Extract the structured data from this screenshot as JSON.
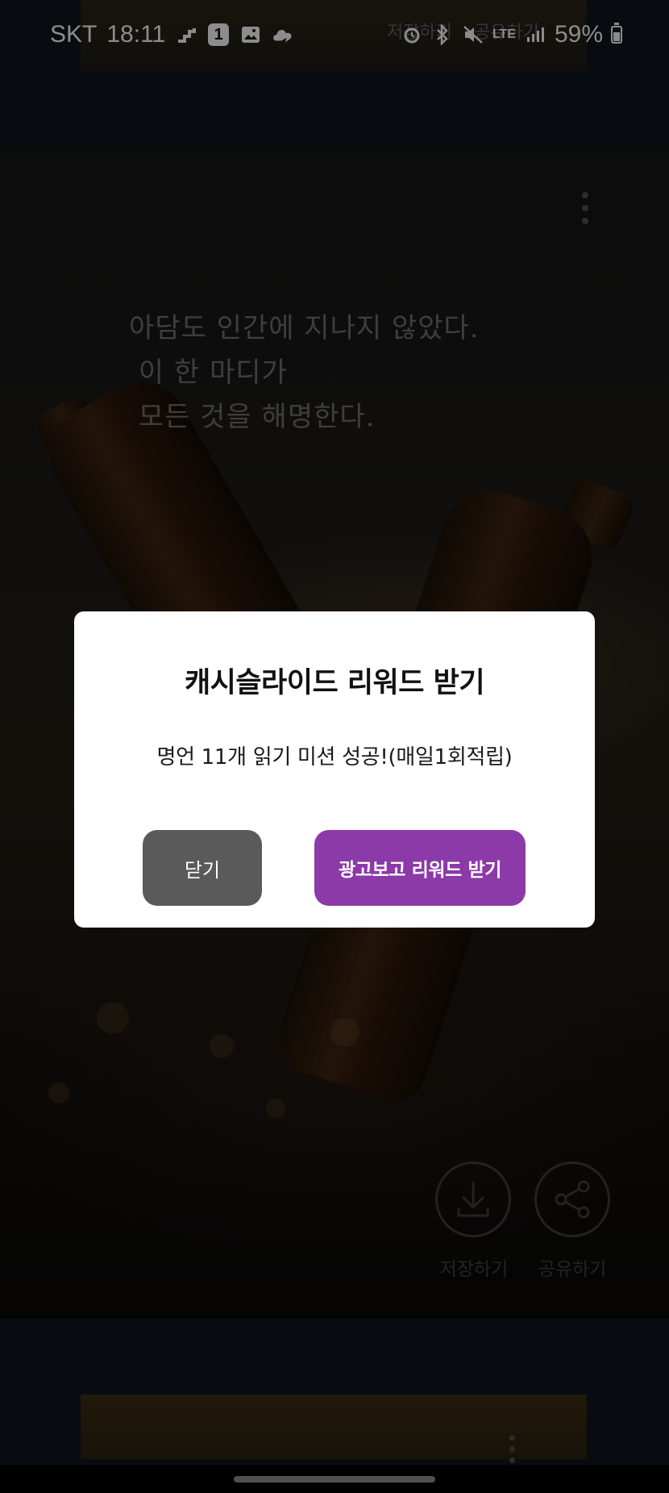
{
  "status_bar": {
    "carrier": "SKT",
    "time": "18:11",
    "notification_badge": "1",
    "network": "LTE",
    "battery": "59%",
    "battery_level": 0.59
  },
  "previous_card": {
    "save_label": "저장하기",
    "share_label": "공유하기"
  },
  "quote_card": {
    "quote": "아담도 인간에 지나지 않았다.\n 이 한 마디가\n 모든 것을 해명한다.",
    "save_label": "저장하기",
    "share_label": "공유하기"
  },
  "dialog": {
    "title": "캐시슬라이드 리워드 받기",
    "message": "명언 11개 읽기 미션 성공!(매일1회적립)",
    "close_label": "닫기",
    "reward_label": "광고보고 리워드 받기"
  },
  "colors": {
    "reward_button": "#8b3aa8",
    "close_button": "#5a5a5a",
    "dialog_bg": "#ffffff"
  }
}
